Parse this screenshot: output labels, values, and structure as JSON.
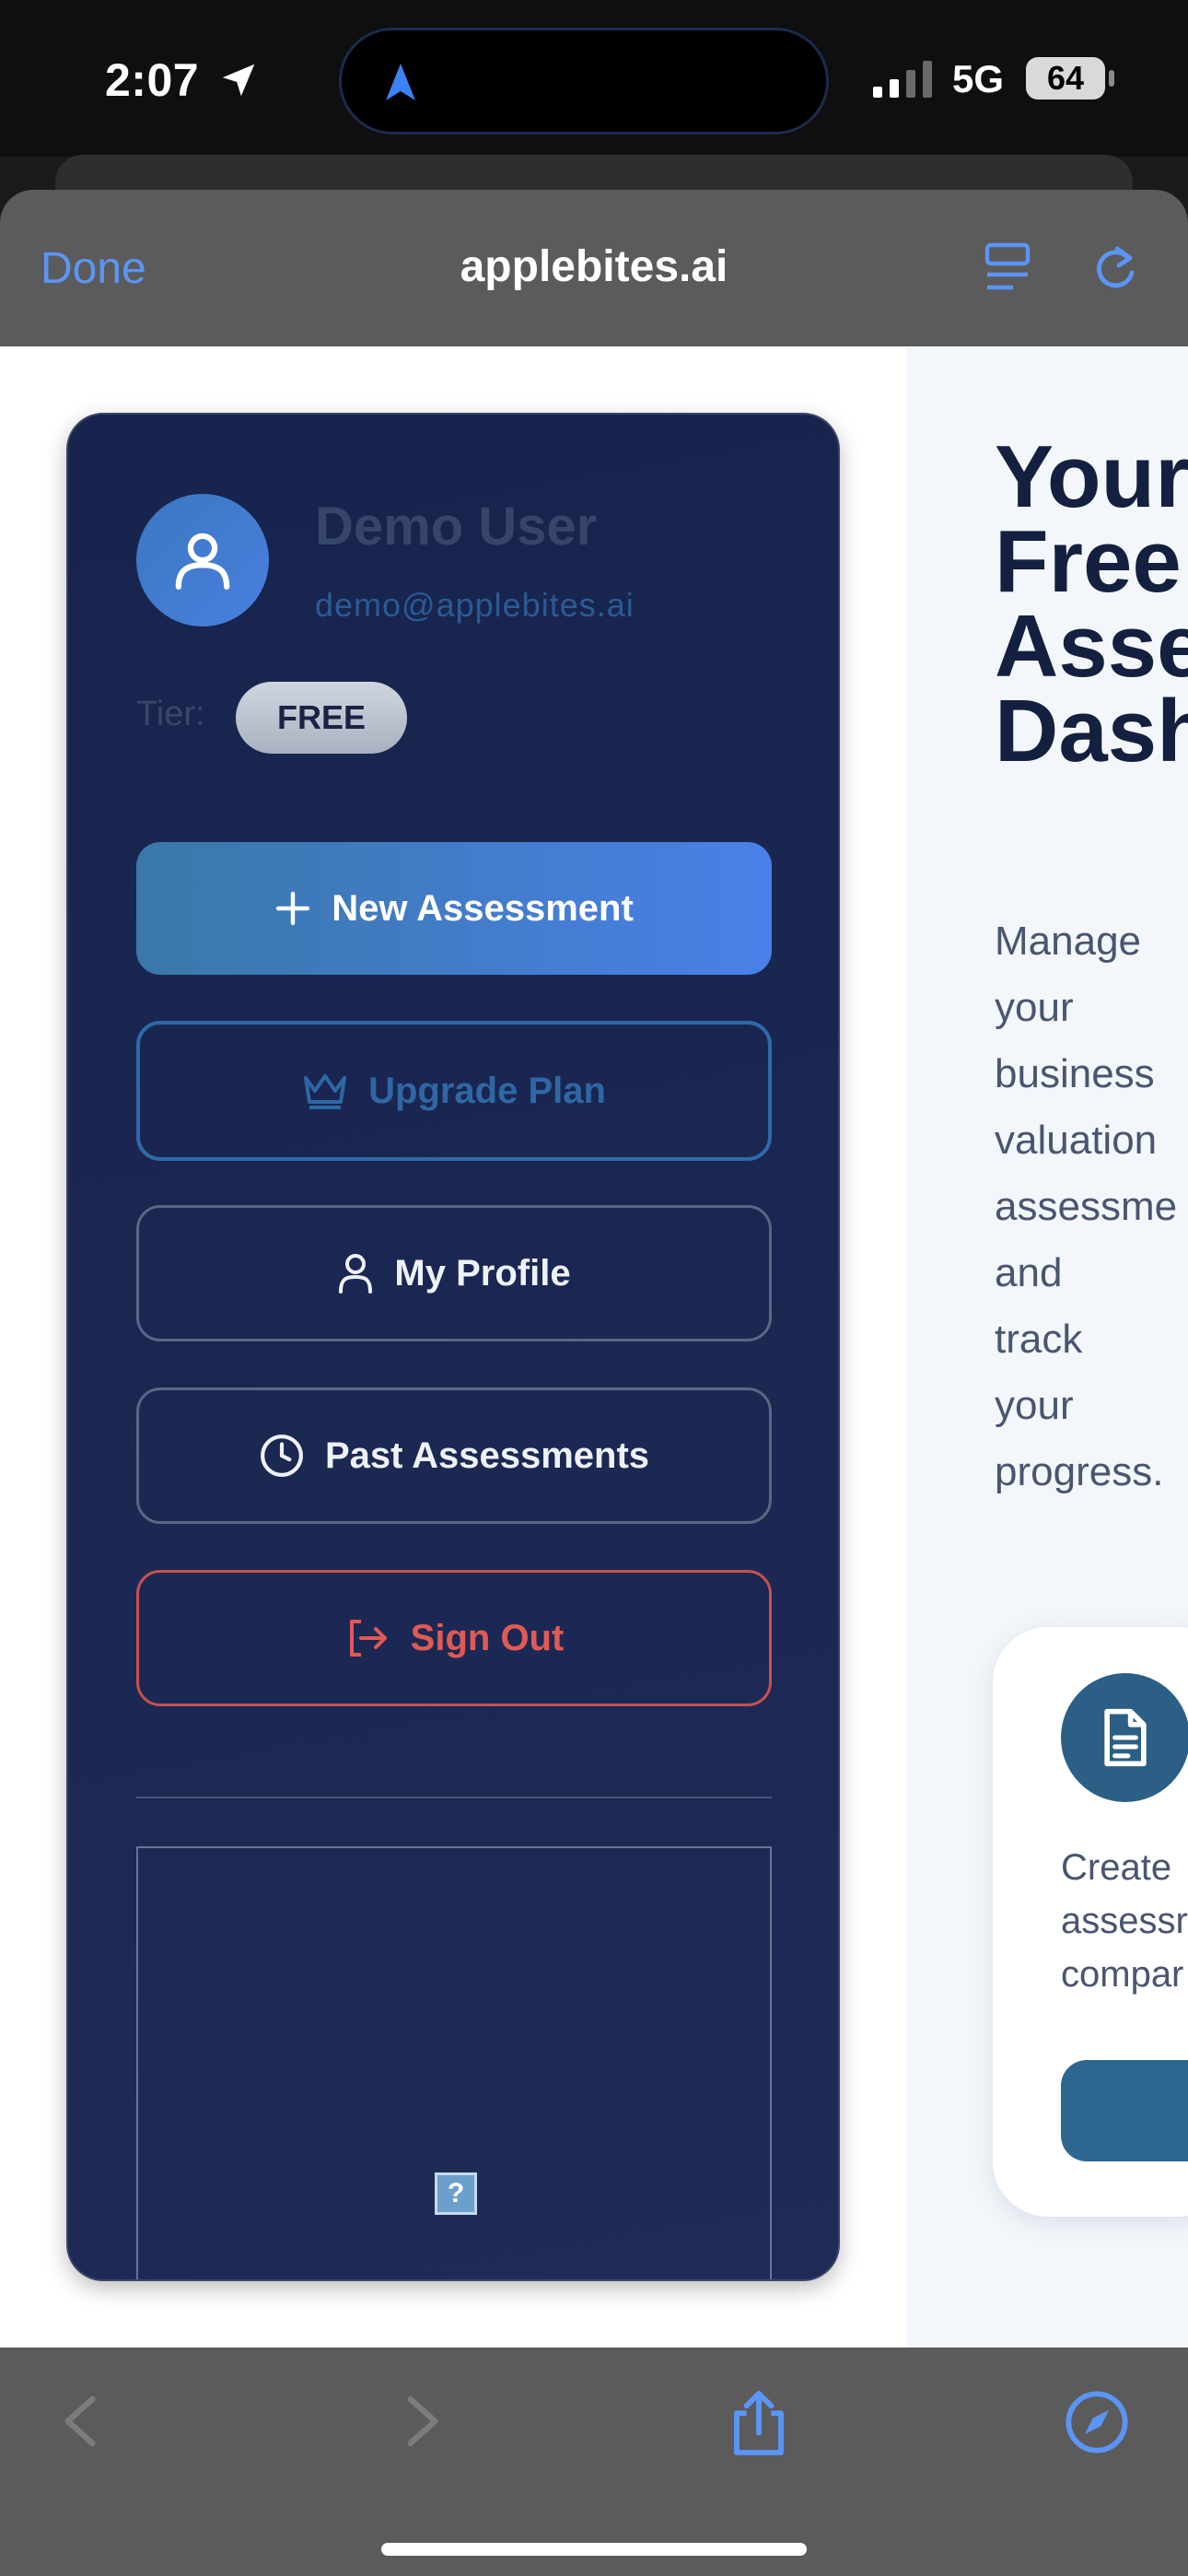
{
  "status_bar": {
    "time": "2:07",
    "network": "5G",
    "battery": "64"
  },
  "browser": {
    "done_label": "Done",
    "url": "applebites.ai"
  },
  "sidebar": {
    "user_name": "Demo User",
    "user_email": "demo@applebites.ai",
    "tier_label": "Tier:",
    "tier_value": "FREE",
    "buttons": {
      "new_assessment": "New Assessment",
      "upgrade_plan": "Upgrade Plan",
      "my_profile": "My Profile",
      "past_assessments": "Past Assessments",
      "sign_out": "Sign Out"
    },
    "broken_image_glyph": "?"
  },
  "main": {
    "heading": "Your\nFree\nAsse\nDash",
    "description": "Manage\nyour\nbusiness\nvaluation\nassessme\nand\ntrack\nyour\nprogress.",
    "card_text": "Create\nassessr\ncompar"
  },
  "colors": {
    "accent_blue": "#4a80e8",
    "sidebar_bg": "#1b2853",
    "signout_red": "#e05a55"
  }
}
